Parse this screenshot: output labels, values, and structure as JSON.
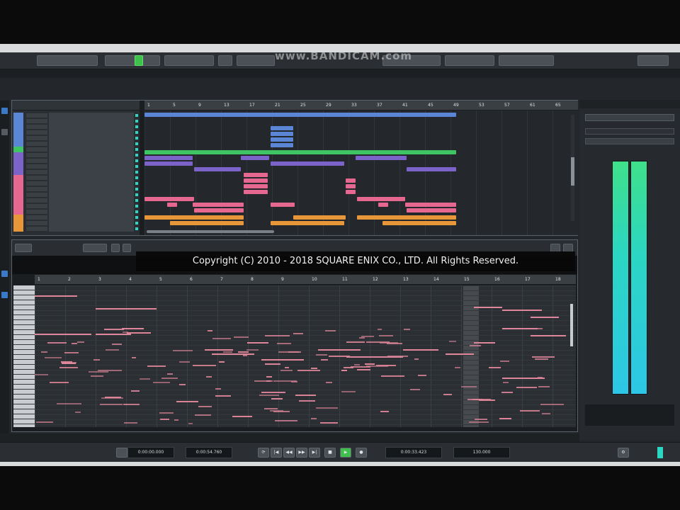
{
  "watermark": "www.BANDICAM.com",
  "copyright": "Copyright (C) 2010 - 2018 SQUARE ENIX CO., LTD. All Rights Reserved.",
  "colors": {
    "accent_play": "#3fbf4c",
    "event_blue": "#5b86d6",
    "event_green": "#3fc463",
    "event_purple": "#7b63c9",
    "event_pink": "#e66890",
    "event_orange": "#e8963a",
    "note_pink": "#e0869a",
    "meter_cyan": "#2bd6c2"
  },
  "project": {
    "ruler_labels": [
      "1",
      "5",
      "9",
      "13",
      "17",
      "21",
      "25",
      "29",
      "33",
      "37",
      "41",
      "45",
      "49",
      "53",
      "57",
      "61",
      "65"
    ]
  },
  "key_editor": {
    "ruler_labels": [
      "1",
      "2",
      "3",
      "4",
      "5",
      "6",
      "7",
      "8",
      "9",
      "10",
      "11",
      "12",
      "13",
      "14",
      "15",
      "16",
      "17",
      "18"
    ]
  },
  "transport": {
    "time_left": "0:00:00.000",
    "time_right": "0:00:54.760",
    "position": "0:00:33.423",
    "tempo": "130.000"
  },
  "icons": [
    "play-icon",
    "stop-icon",
    "rewind-icon",
    "forward-icon",
    "record-icon",
    "cycle-icon",
    "gear-icon",
    "close-icon"
  ]
}
